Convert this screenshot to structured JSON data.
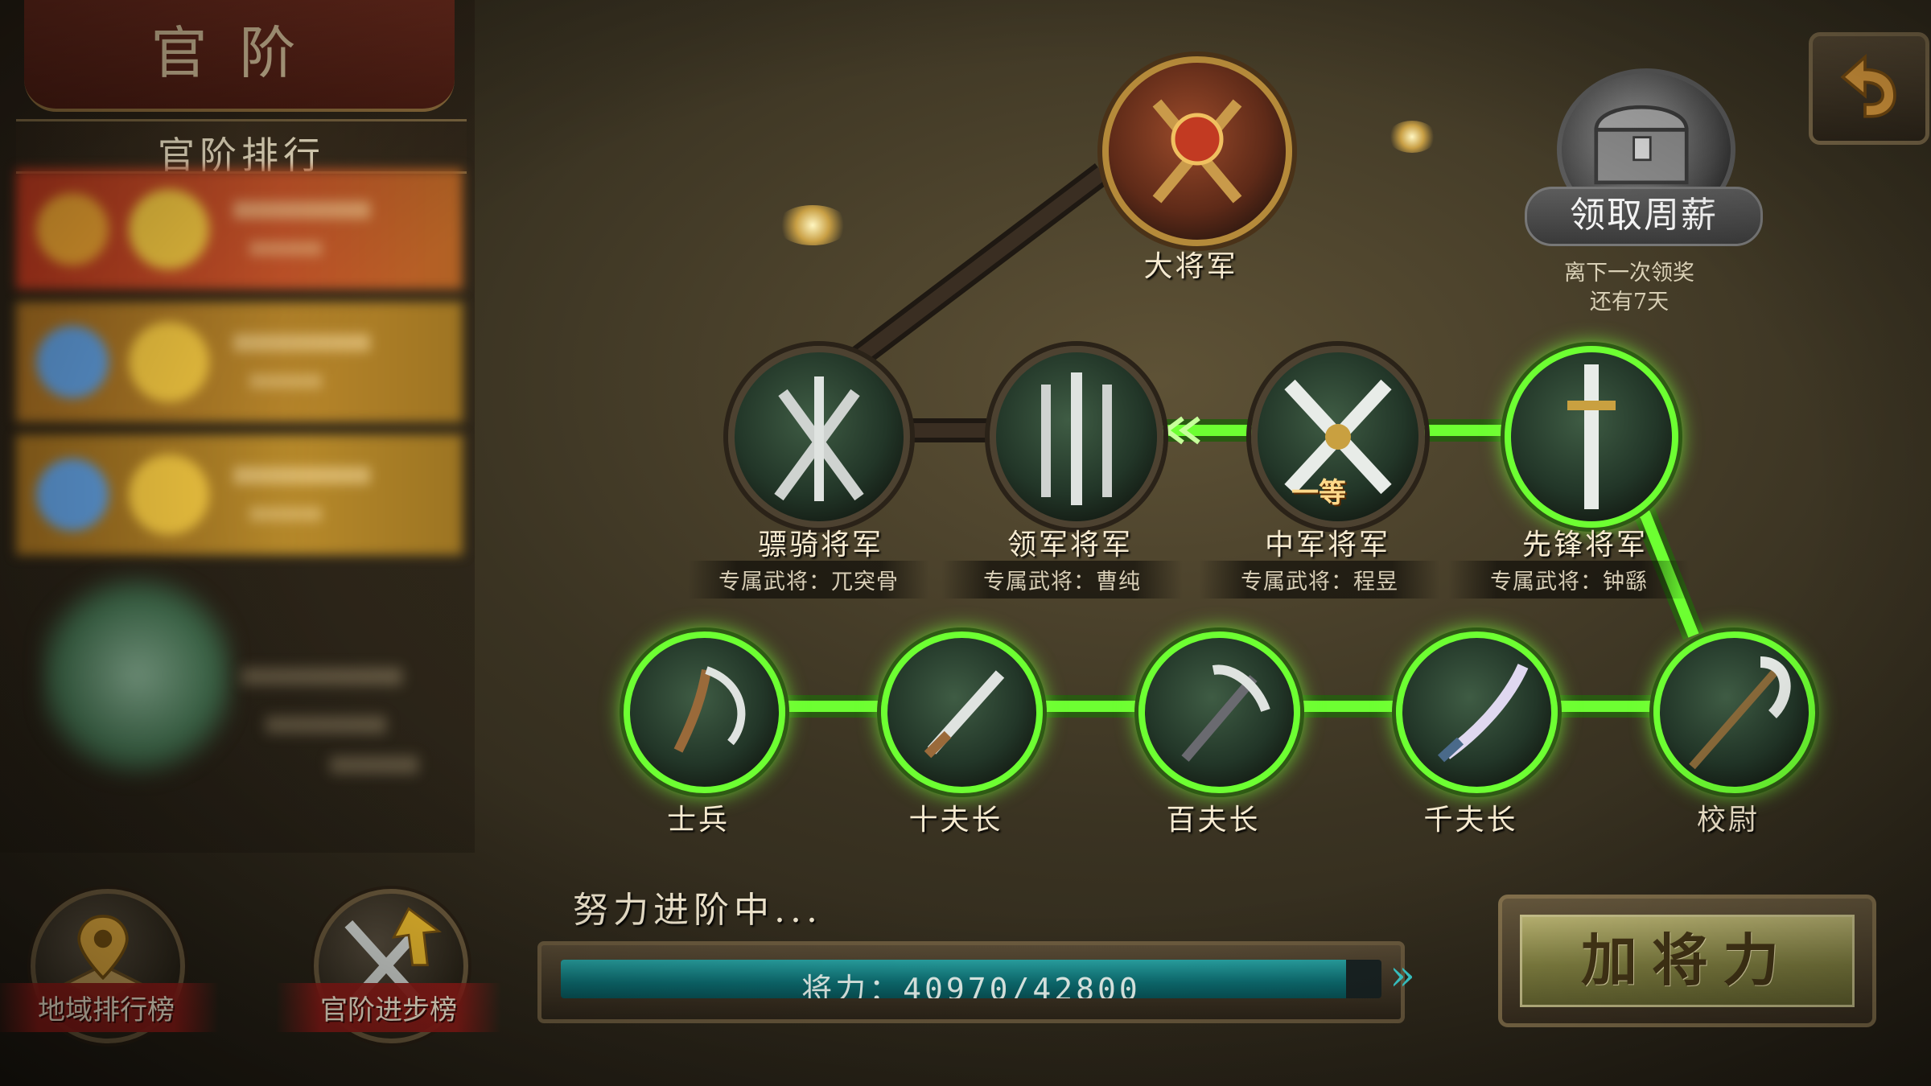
{
  "left_panel": {
    "banner_title": "官阶",
    "ranking_title": "官阶排行"
  },
  "bottom_buttons": {
    "region_ranking": "地域排行榜",
    "rank_progress": "官阶进步榜"
  },
  "weekly_reward": {
    "button_label": "领取周薪",
    "countdown_line1": "离下一次领奖",
    "countdown_line2": "还有7天"
  },
  "ranks": {
    "top": {
      "name": "大将军"
    },
    "general_row": [
      {
        "name": "骠骑将军",
        "exclusive": "专属武将：兀突骨"
      },
      {
        "name": "领军将军",
        "exclusive": "专属武将：曹纯"
      },
      {
        "name": "中军将军",
        "exclusive": "专属武将：程昱",
        "grade": "一等"
      },
      {
        "name": "先锋将军",
        "exclusive": "专属武将：钟繇"
      }
    ],
    "soldier_row": [
      {
        "name": "士兵"
      },
      {
        "name": "十夫长"
      },
      {
        "name": "百夫长"
      },
      {
        "name": "千夫长"
      },
      {
        "name": "校尉"
      }
    ]
  },
  "progress": {
    "caption": "努力进阶中...",
    "label": "将力：40970/42800",
    "current": 40970,
    "max": 42800
  },
  "add_power_button": "加将力",
  "colors": {
    "active_track": "#6dff32",
    "inactive_track": "#3a2e22",
    "progress_fill": "#1a9a9a"
  }
}
